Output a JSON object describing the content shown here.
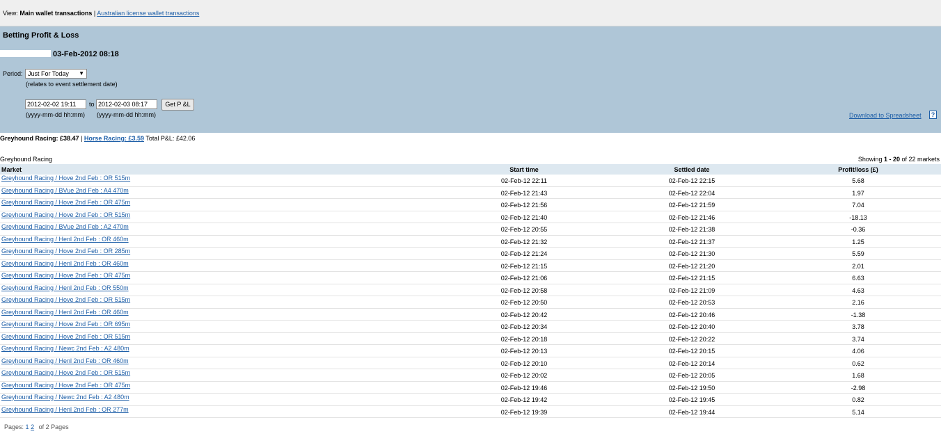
{
  "viewbar": {
    "label": "View:",
    "main_wallet": "Main wallet transactions",
    "separator": "|",
    "aus_wallet_link": "Australian license wallet transactions"
  },
  "panel": {
    "title": "Betting Profit & Loss",
    "datetime": "03-Feb-2012 08:18",
    "period_label": "Period:",
    "period_value": "Just For Today",
    "period_note": "(relates to event settlement date)",
    "from_value": "2012-02-02 19:11",
    "to_label": "to",
    "to_value": "2012-02-03 08:17",
    "format_hint": "(yyyy-mm-dd hh:mm)",
    "get_button": "Get P &L",
    "download_link": "Download to Spreadsheet",
    "help_icon": "?"
  },
  "summary": {
    "greyhound": "Greyhound Racing: £38.47",
    "separator": "|",
    "horse": "Horse Racing: £3.59",
    "total": "Total P&L:  £42.06"
  },
  "section": {
    "label": "Greyhound Racing",
    "showing_prefix": "Showing ",
    "showing_range": "1 - 20",
    "showing_suffix": " of 22 markets"
  },
  "table": {
    "headers": [
      "Market",
      "Start time",
      "Settled date",
      "Profit/loss (£)"
    ],
    "rows": [
      [
        "Greyhound Racing / Hove 2nd Feb : OR 515m",
        "02-Feb-12 22:11",
        "02-Feb-12 22:15",
        "5.68"
      ],
      [
        "Greyhound Racing / BVue 2nd Feb : A4 470m",
        "02-Feb-12 21:43",
        "02-Feb-12 22:04",
        "1.97"
      ],
      [
        "Greyhound Racing / Hove 2nd Feb : OR 475m",
        "02-Feb-12 21:56",
        "02-Feb-12 21:59",
        "7.04"
      ],
      [
        "Greyhound Racing / Hove 2nd Feb : OR 515m",
        "02-Feb-12 21:40",
        "02-Feb-12 21:46",
        "-18.13"
      ],
      [
        "Greyhound Racing / BVue 2nd Feb : A2 470m",
        "02-Feb-12 20:55",
        "02-Feb-12 21:38",
        "-0.36"
      ],
      [
        "Greyhound Racing / Henl 2nd Feb : OR 460m",
        "02-Feb-12 21:32",
        "02-Feb-12 21:37",
        "1.25"
      ],
      [
        "Greyhound Racing / Hove 2nd Feb : OR 285m",
        "02-Feb-12 21:24",
        "02-Feb-12 21:30",
        "5.59"
      ],
      [
        "Greyhound Racing / Henl 2nd Feb : OR 460m",
        "02-Feb-12 21:15",
        "02-Feb-12 21:20",
        "2.01"
      ],
      [
        "Greyhound Racing / Hove 2nd Feb : OR 475m",
        "02-Feb-12 21:06",
        "02-Feb-12 21:15",
        "6.63"
      ],
      [
        "Greyhound Racing / Henl 2nd Feb : OR 550m",
        "02-Feb-12 20:58",
        "02-Feb-12 21:09",
        "4.63"
      ],
      [
        "Greyhound Racing / Hove 2nd Feb : OR 515m",
        "02-Feb-12 20:50",
        "02-Feb-12 20:53",
        "2.16"
      ],
      [
        "Greyhound Racing / Henl 2nd Feb : OR 460m",
        "02-Feb-12 20:42",
        "02-Feb-12 20:46",
        "-1.38"
      ],
      [
        "Greyhound Racing / Hove 2nd Feb : OR 695m",
        "02-Feb-12 20:34",
        "02-Feb-12 20:40",
        "3.78"
      ],
      [
        "Greyhound Racing / Hove 2nd Feb : OR 515m",
        "02-Feb-12 20:18",
        "02-Feb-12 20:22",
        "3.74"
      ],
      [
        "Greyhound Racing / Newc 2nd Feb : A2 480m",
        "02-Feb-12 20:13",
        "02-Feb-12 20:15",
        "4.06"
      ],
      [
        "Greyhound Racing / Henl 2nd Feb : OR 460m",
        "02-Feb-12 20:10",
        "02-Feb-12 20:14",
        "0.62"
      ],
      [
        "Greyhound Racing / Hove 2nd Feb : OR 515m",
        "02-Feb-12 20:02",
        "02-Feb-12 20:05",
        "1.68"
      ],
      [
        "Greyhound Racing / Hove 2nd Feb : OR 475m",
        "02-Feb-12 19:46",
        "02-Feb-12 19:50",
        "-2.98"
      ],
      [
        "Greyhound Racing / Newc 2nd Feb : A2 480m",
        "02-Feb-12 19:42",
        "02-Feb-12 19:45",
        "0.82"
      ],
      [
        "Greyhound Racing / Henl 2nd Feb : OR 277m",
        "02-Feb-12 19:39",
        "02-Feb-12 19:44",
        "5.14"
      ]
    ]
  },
  "pagination": {
    "label": "Pages:",
    "page1": "1",
    "page2": "2",
    "suffix": "of 2 Pages"
  }
}
